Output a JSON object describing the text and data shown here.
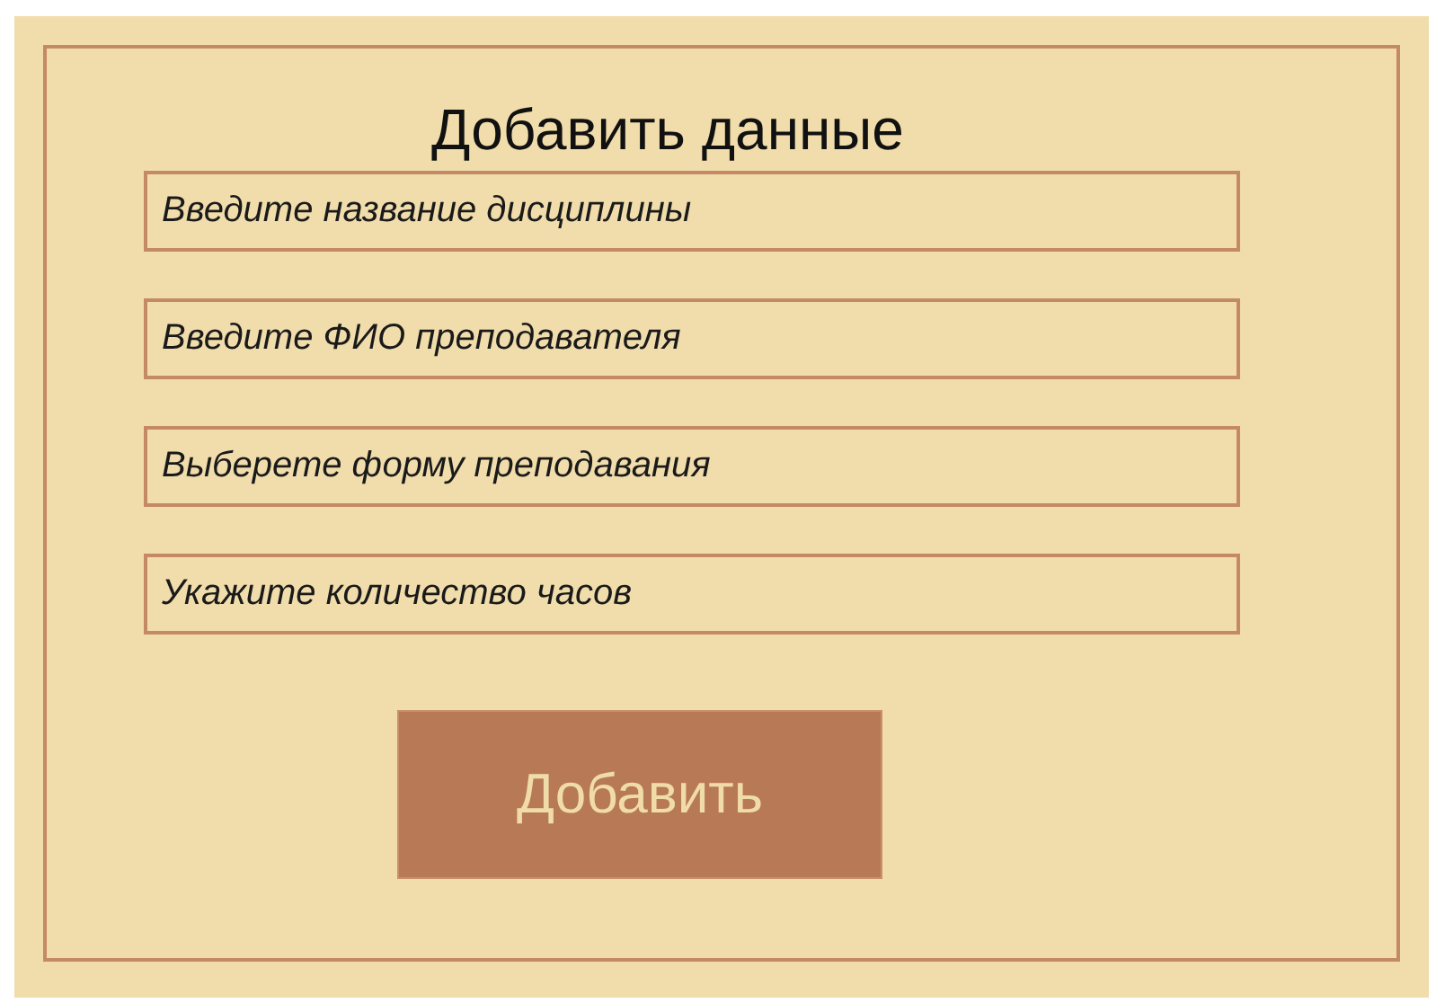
{
  "title": "Добавить данные",
  "fields": [
    {
      "placeholder": "Введите название дисциплины"
    },
    {
      "placeholder": "Введите ФИО преподавателя"
    },
    {
      "placeholder": "Выберете форму преподавания"
    },
    {
      "placeholder": "Укажите количество часов"
    }
  ],
  "button": "Добавить"
}
